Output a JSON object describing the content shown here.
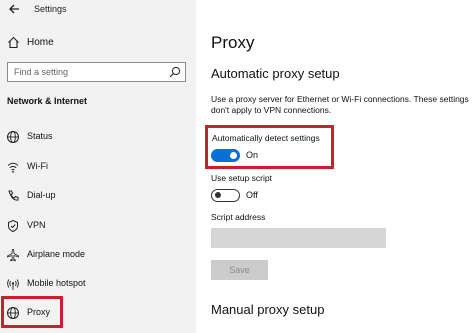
{
  "window": {
    "title": "Settings"
  },
  "sidebar": {
    "home_label": "Home",
    "search_placeholder": "Find a setting",
    "section_header": "Network & Internet",
    "items": [
      {
        "label": "Status",
        "icon": "globe-icon"
      },
      {
        "label": "Wi-Fi",
        "icon": "wifi-icon"
      },
      {
        "label": "Dial-up",
        "icon": "phone-icon"
      },
      {
        "label": "VPN",
        "icon": "vpn-icon"
      },
      {
        "label": "Airplane mode",
        "icon": "airplane-icon"
      },
      {
        "label": "Mobile hotspot",
        "icon": "hotspot-icon"
      },
      {
        "label": "Proxy",
        "icon": "globe-icon"
      }
    ]
  },
  "main": {
    "title": "Proxy",
    "automatic": {
      "heading": "Automatic proxy setup",
      "description": "Use a proxy server for Ethernet or Wi-Fi connections. These settings\ndon't apply to VPN connections.",
      "auto_detect_label": "Automatically detect settings",
      "auto_detect_state": "On",
      "setup_script_label": "Use setup script",
      "setup_script_state": "Off",
      "script_address_label": "Script address",
      "script_address_value": "",
      "save_label": "Save"
    },
    "manual": {
      "heading": "Manual proxy setup"
    }
  },
  "colors": {
    "accent": "#0a6fd6",
    "highlight": "#c91f2e",
    "sidebar_bg": "#f2f2f2"
  }
}
